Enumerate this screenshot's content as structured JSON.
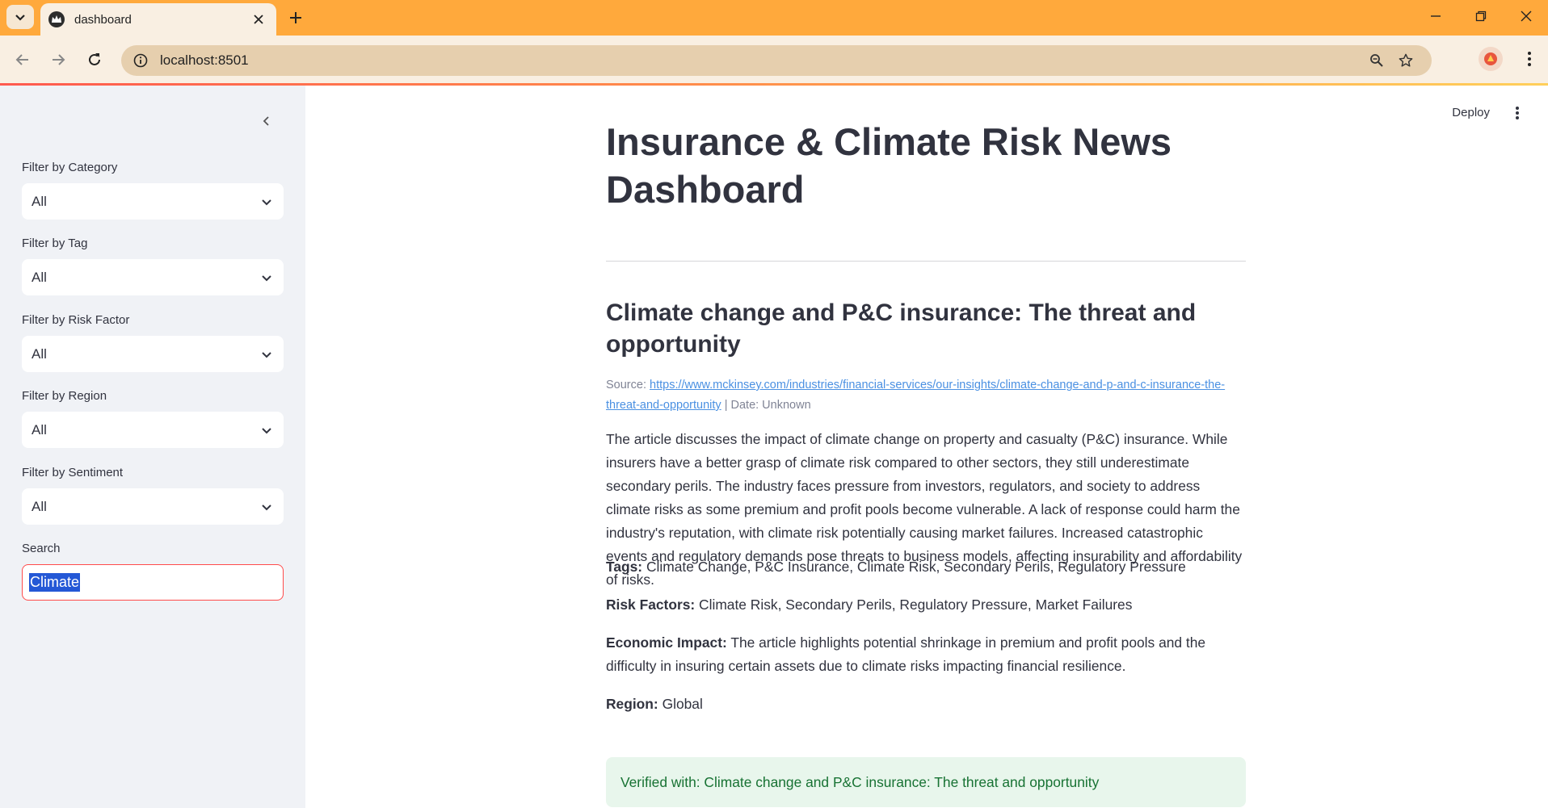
{
  "browser": {
    "tab_title": "dashboard",
    "url": "localhost:8501"
  },
  "sidebar": {
    "filters": [
      {
        "label": "Filter by Category",
        "value": "All"
      },
      {
        "label": "Filter by Tag",
        "value": "All"
      },
      {
        "label": "Filter by Risk Factor",
        "value": "All"
      },
      {
        "label": "Filter by Region",
        "value": "All"
      },
      {
        "label": "Filter by Sentiment",
        "value": "All"
      }
    ],
    "search": {
      "label": "Search",
      "value": "Climate"
    }
  },
  "header": {
    "deploy_label": "Deploy"
  },
  "main": {
    "title": "Insurance & Climate Risk News Dashboard",
    "article": {
      "title": "Climate change and P&C insurance: The threat and opportunity",
      "source_label": "Source:",
      "source_url": "https://www.mckinsey.com/industries/financial-services/our-insights/climate-change-and-p-and-c-insurance-the-threat-and-opportunity",
      "date_text": "| Date: Unknown",
      "summary": "The article discusses the impact of climate change on property and casualty (P&C) insurance. While insurers have a better grasp of climate risk compared to other sectors, they still underestimate secondary perils. The industry faces pressure from investors, regulators, and society to address climate risks as some premium and profit pools become vulnerable. A lack of response could harm the industry's reputation, with climate risk potentially causing market failures. Increased catastrophic events and regulatory demands pose threats to business models, affecting insurability and affordability of risks.",
      "tags_label": "Tags:",
      "tags": "Climate Change, P&C Insurance, Climate Risk, Secondary Perils, Regulatory Pressure",
      "risk_label": "Risk Factors:",
      "risk_factors": "Climate Risk, Secondary Perils, Regulatory Pressure, Market Failures",
      "impact_label": "Economic Impact:",
      "economic_impact": "The article highlights potential shrinkage in premium and profit pools and the difficulty in insuring certain assets due to climate risks impacting financial resilience.",
      "region_label": "Region:",
      "region": "Global",
      "verified_text": "Verified with: Climate change and P&C insurance: The threat and opportunity"
    }
  },
  "colors": {
    "tabstrip": "#ffa93c",
    "toolbar": "#f9efe2",
    "sidebar": "#f0f2f6",
    "search_border": "#ff4b4b",
    "link": "#4a90e2",
    "success_bg": "#e8f6ec",
    "success_text": "#177233"
  },
  "icons": {
    "tab_menu": "chevron-down-icon",
    "favicon": "streamlit-crown-icon",
    "tab_close": "close-icon",
    "new_tab": "plus-icon",
    "minimize": "minimize-icon",
    "restore": "restore-icon",
    "window_close": "close-icon",
    "back": "arrow-left-icon",
    "forward": "arrow-right-icon",
    "reload": "reload-icon",
    "site_info": "info-icon",
    "zoom": "zoom-icon",
    "bookmark": "star-icon",
    "profile": "avatar-icon",
    "browser_menu": "kebab-icon",
    "sidebar_collapse": "chevron-left-icon",
    "select_dropdown": "chevron-down-icon",
    "app_menu": "kebab-icon"
  }
}
